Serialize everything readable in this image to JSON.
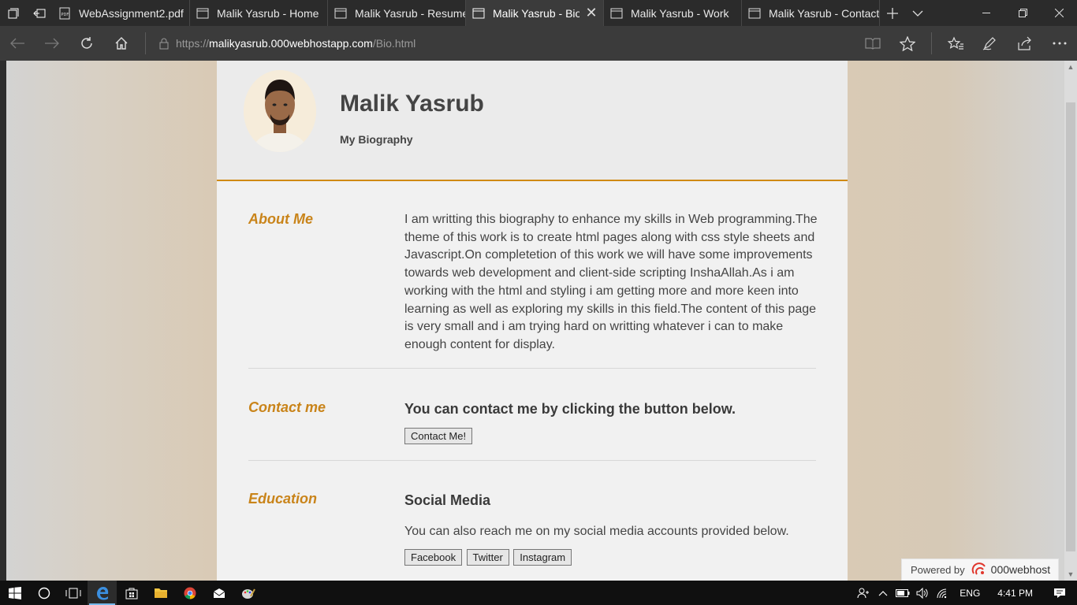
{
  "tabs": [
    {
      "title": "WebAssignment2.pdf",
      "icon": "pdf-icon",
      "active": false
    },
    {
      "title": "Malik Yasrub - Home",
      "icon": "page-icon",
      "active": false
    },
    {
      "title": "Malik Yasrub - Resume",
      "icon": "page-icon",
      "active": false
    },
    {
      "title": "Malik Yasrub - Biog",
      "icon": "page-icon",
      "active": true
    },
    {
      "title": "Malik Yasrub - Work",
      "icon": "page-icon",
      "active": false
    },
    {
      "title": "Malik Yasrub - Contact",
      "icon": "page-icon",
      "active": false
    }
  ],
  "address": {
    "scheme": "https://",
    "host": "malikyasrub.000webhostapp.com",
    "path": "/Bio.html"
  },
  "header": {
    "title": "Malik Yasrub",
    "subtitle": "My Biography"
  },
  "about": {
    "heading": "About Me",
    "text": "I am writting this biography to enhance my skills in Web programming.The theme of this work is to create html pages along with css style sheets and Javascript.On completetion of this work we will have some improvements towards web development and client-side scripting InshaAllah.As i am working with the html and styling i am getting more and more keen into learning as well as exploring my skills in this field.The content of this page is very small and i am trying hard on writting whatever i can to make enough content for display."
  },
  "contact": {
    "heading": "Contact me",
    "text": "You can contact me by clicking the button below.",
    "button": "Contact Me!"
  },
  "education": {
    "heading": "Education",
    "subheading": "Social Media",
    "text": "You can also reach me on my social media accounts provided below.",
    "buttons": [
      "Facebook",
      "Twitter",
      "Instagram"
    ]
  },
  "powered": {
    "prefix": "Powered by",
    "brand": "000webhost"
  },
  "taskbar": {
    "lang": "ENG",
    "time": "4:41 PM"
  },
  "colors": {
    "accent": "#d08a12",
    "heading": "#c9841a",
    "active_tab": "#3b3b3b",
    "taskbar_highlight": "#76b9ed"
  }
}
